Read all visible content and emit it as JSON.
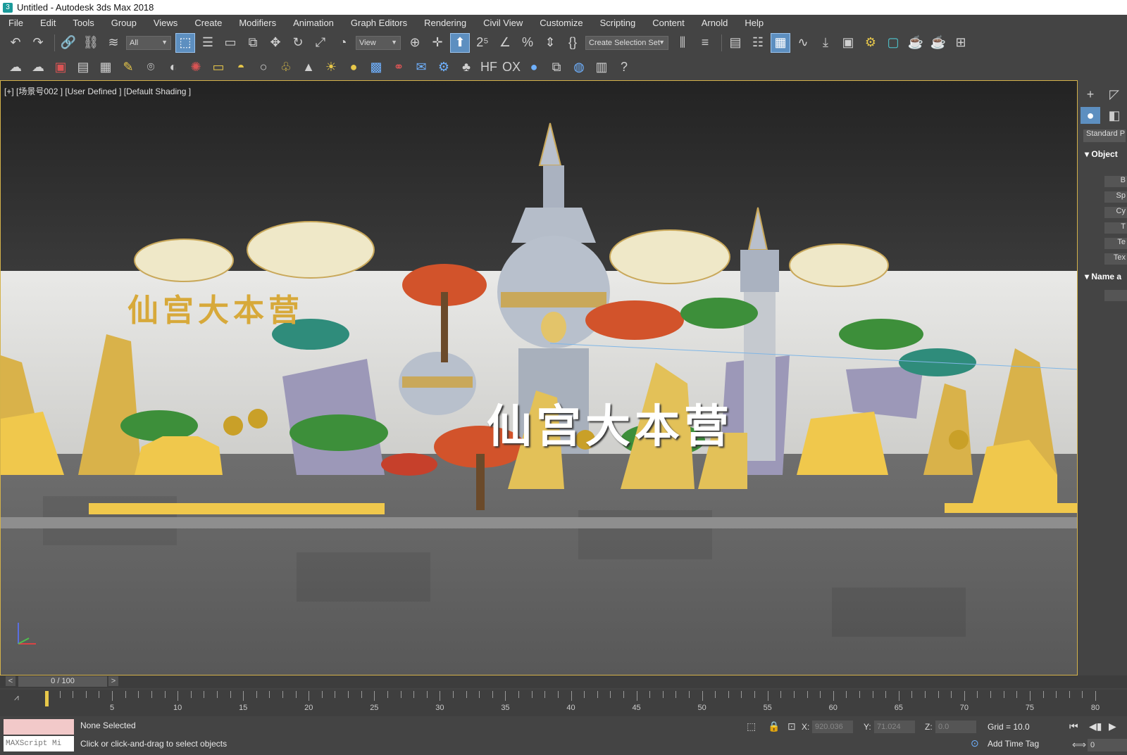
{
  "window": {
    "title": "Untitled - Autodesk 3ds Max 2018"
  },
  "menu": [
    {
      "label": "File"
    },
    {
      "label": "Edit"
    },
    {
      "label": "Tools"
    },
    {
      "label": "Group"
    },
    {
      "label": "Views"
    },
    {
      "label": "Create"
    },
    {
      "label": "Modifiers"
    },
    {
      "label": "Animation"
    },
    {
      "label": "Graph Editors"
    },
    {
      "label": "Rendering"
    },
    {
      "label": "Civil View"
    },
    {
      "label": "Customize"
    },
    {
      "label": "Scripting"
    },
    {
      "label": "Content"
    },
    {
      "label": "Arnold"
    },
    {
      "label": "Help"
    }
  ],
  "toolbar": {
    "filter_value": "All",
    "refcoord_value": "View",
    "selection_set_value": "Create Selection Set"
  },
  "viewport": {
    "label": "[+] [场景号002 ] [User Defined ] [Default Shading ]",
    "wall_text": "仙宫大本营",
    "center_text": "仙宫大本营"
  },
  "command_panel": {
    "category": "Standard P",
    "rollout_object": "Object",
    "rollout_name": "Name a",
    "object_buttons": [
      "B",
      "Sp",
      "Cy",
      "T",
      "Te",
      "Tex"
    ]
  },
  "time_slider": {
    "value": "0 / 100"
  },
  "trackbar": {
    "start": 0,
    "end": 80,
    "current": 0,
    "tick_labels": [
      "5",
      "10",
      "15",
      "20",
      "25",
      "30",
      "35",
      "40",
      "45",
      "50",
      "55",
      "60",
      "65",
      "70",
      "75",
      "80"
    ]
  },
  "status": {
    "selection": "None Selected",
    "prompt": "Click or click-and-drag to select objects",
    "maxscript_placeholder": "MAXScript Mi",
    "x_label": "X:",
    "x_value": "920.036",
    "y_label": "Y:",
    "y_value": "71.024",
    "z_label": "Z:",
    "z_value": "0.0",
    "grid": "Grid = 10.0",
    "add_time_tag": "Add Time Tag",
    "frame": "0"
  }
}
